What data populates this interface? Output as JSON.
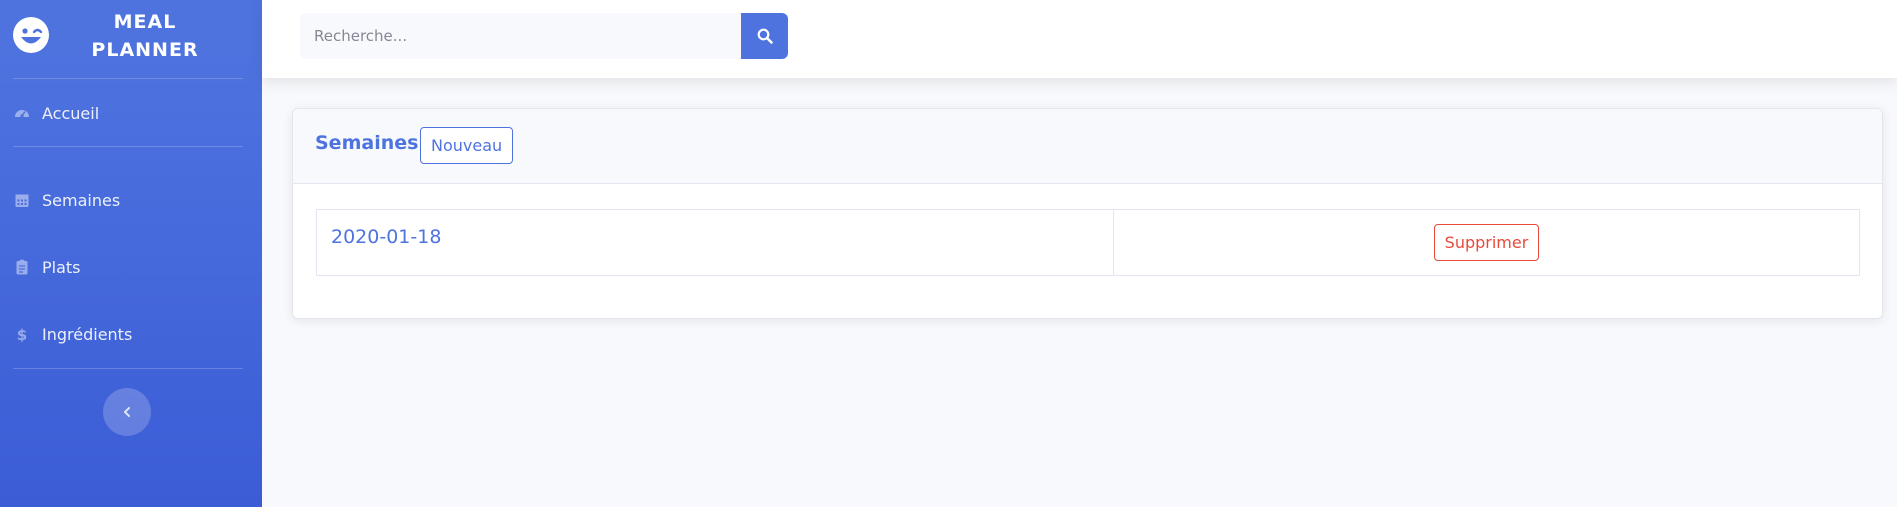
{
  "brand": {
    "name": "Meal Planner",
    "icon": "laugh-wink-icon"
  },
  "sidebar": {
    "items": [
      {
        "label": "Accueil",
        "icon": "tachometer-icon"
      },
      {
        "label": "Semaines",
        "icon": "calendar-icon"
      },
      {
        "label": "Plats",
        "icon": "clipboard-icon"
      },
      {
        "label": "Ingrédients",
        "icon": "dollar-icon"
      }
    ],
    "toggle_icon": "chevron-left-icon"
  },
  "search": {
    "placeholder": "Recherche...",
    "value": "",
    "button_icon": "search-icon"
  },
  "card": {
    "title": "Semaines -",
    "new_button": "Nouveau",
    "rows": [
      {
        "date": "2020-01-18",
        "delete_label": "Supprimer"
      }
    ]
  },
  "colors": {
    "primary": "#4e73df",
    "danger": "#e74a3b",
    "background": "#f8f9fc"
  }
}
